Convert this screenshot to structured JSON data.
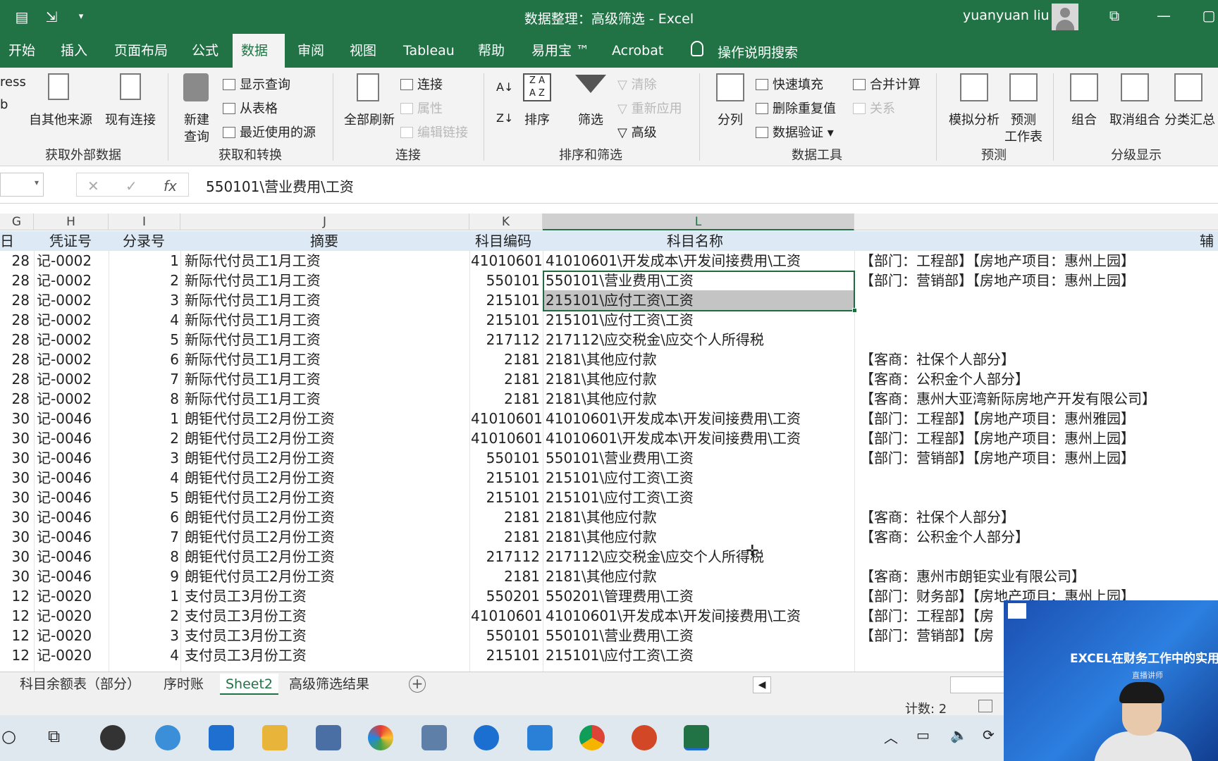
{
  "titlebar": {
    "title": "数据整理：高级筛选  -  Excel",
    "user": "yuanyuan liu",
    "qa_dropdown": "▾",
    "win_restore": "⧉",
    "win_minimize": "—",
    "win_max": "▢"
  },
  "tabs": {
    "items": [
      "开始",
      "插入",
      "页面布局",
      "公式",
      "数据",
      "审阅",
      "视图",
      "Tableau",
      "帮助",
      "易用宝 ™",
      "Acrobat"
    ],
    "active": "数据",
    "tellme": "操作说明搜索"
  },
  "ribbon": {
    "partial_left": [
      "ress",
      "b"
    ],
    "get_external": {
      "from_other": "自其他来源",
      "existing": "现有连接",
      "label": "获取外部数据"
    },
    "get_transform": {
      "new_query": "新建",
      "new_query2": "查询",
      "show_query": "显示查询",
      "from_table": "从表格",
      "recent": "最近使用的源",
      "label": "获取和转换"
    },
    "connections": {
      "refresh_all": "全部刷新",
      "connections": "连接",
      "properties": "属性",
      "edit_links": "编辑链接",
      "label": "连接"
    },
    "sort_filter": {
      "sort": "排序",
      "filter": "筛选",
      "clear": "清除",
      "reapply": "重新应用",
      "advanced": "高级",
      "label": "排序和筛选"
    },
    "data_tools": {
      "text_to_columns": "分列",
      "flash_fill": "快速填充",
      "remove_dup": "删除重复值",
      "validation": "数据验证",
      "consolidate": "合并计算",
      "relationships": "关系",
      "label": "数据工具"
    },
    "forecast": {
      "whatif": "模拟分析",
      "sheet": "预测",
      "sheet2": "工作表",
      "label": "预测"
    },
    "outline": {
      "group": "组合",
      "ungroup": "取消组合",
      "subtotal": "分类汇总",
      "label": "分级显示"
    }
  },
  "formula_bar": {
    "content": "550101\\营业费用\\工资",
    "fx": "fx",
    "cancel": "✕",
    "enter": "✓"
  },
  "columns": [
    "G",
    "H",
    "I",
    "J",
    "K",
    "L"
  ],
  "table": {
    "header": {
      "g": "日",
      "h": "凭证号",
      "i": "分录号",
      "j": "摘要",
      "k": "科目编码",
      "l": "科目名称",
      "n": "辅"
    },
    "rows": [
      {
        "g": "28",
        "h": "记-0002",
        "i": "1",
        "j": "新际代付员工1月工资",
        "k": "41010601",
        "l": "41010601\\开发成本\\开发间接费用\\工资",
        "m": "【部门：工程部】【房地产项目：惠州上园】"
      },
      {
        "g": "28",
        "h": "记-0002",
        "i": "2",
        "j": "新际代付员工1月工资",
        "k": "550101",
        "l": "550101\\营业费用\\工资",
        "m": "【部门：营销部】【房地产项目：惠州上园】"
      },
      {
        "g": "28",
        "h": "记-0002",
        "i": "3",
        "j": "新际代付员工1月工资",
        "k": "215101",
        "l": "215101\\应付工资\\工资",
        "m": ""
      },
      {
        "g": "28",
        "h": "记-0002",
        "i": "4",
        "j": "新际代付员工1月工资",
        "k": "215101",
        "l": "215101\\应付工资\\工资",
        "m": ""
      },
      {
        "g": "28",
        "h": "记-0002",
        "i": "5",
        "j": "新际代付员工1月工资",
        "k": "217112",
        "l": "217112\\应交税金\\应交个人所得税",
        "m": ""
      },
      {
        "g": "28",
        "h": "记-0002",
        "i": "6",
        "j": "新际代付员工1月工资",
        "k": "2181",
        "l": "2181\\其他应付款",
        "m": "【客商：社保个人部分】"
      },
      {
        "g": "28",
        "h": "记-0002",
        "i": "7",
        "j": "新际代付员工1月工资",
        "k": "2181",
        "l": "2181\\其他应付款",
        "m": "【客商：公积金个人部分】"
      },
      {
        "g": "28",
        "h": "记-0002",
        "i": "8",
        "j": "新际代付员工1月工资",
        "k": "2181",
        "l": "2181\\其他应付款",
        "m": "【客商：惠州大亚湾新际房地产开发有限公司】"
      },
      {
        "g": "30",
        "h": "记-0046",
        "i": "1",
        "j": "朗钜代付员工2月份工资",
        "k": "41010601",
        "l": "41010601\\开发成本\\开发间接费用\\工资",
        "m": "【部门：工程部】【房地产项目：惠州雅园】"
      },
      {
        "g": "30",
        "h": "记-0046",
        "i": "2",
        "j": "朗钜代付员工2月份工资",
        "k": "41010601",
        "l": "41010601\\开发成本\\开发间接费用\\工资",
        "m": "【部门：工程部】【房地产项目：惠州上园】"
      },
      {
        "g": "30",
        "h": "记-0046",
        "i": "3",
        "j": "朗钜代付员工2月份工资",
        "k": "550101",
        "l": "550101\\营业费用\\工资",
        "m": "【部门：营销部】【房地产项目：惠州上园】"
      },
      {
        "g": "30",
        "h": "记-0046",
        "i": "4",
        "j": "朗钜代付员工2月份工资",
        "k": "215101",
        "l": "215101\\应付工资\\工资",
        "m": ""
      },
      {
        "g": "30",
        "h": "记-0046",
        "i": "5",
        "j": "朗钜代付员工2月份工资",
        "k": "215101",
        "l": "215101\\应付工资\\工资",
        "m": ""
      },
      {
        "g": "30",
        "h": "记-0046",
        "i": "6",
        "j": "朗钜代付员工2月份工资",
        "k": "2181",
        "l": "2181\\其他应付款",
        "m": "【客商：社保个人部分】"
      },
      {
        "g": "30",
        "h": "记-0046",
        "i": "7",
        "j": "朗钜代付员工2月份工资",
        "k": "2181",
        "l": "2181\\其他应付款",
        "m": "【客商：公积金个人部分】"
      },
      {
        "g": "30",
        "h": "记-0046",
        "i": "8",
        "j": "朗钜代付员工2月份工资",
        "k": "217112",
        "l": "217112\\应交税金\\应交个人所得税",
        "m": ""
      },
      {
        "g": "30",
        "h": "记-0046",
        "i": "9",
        "j": "朗钜代付员工2月份工资",
        "k": "2181",
        "l": "2181\\其他应付款",
        "m": "【客商：惠州市朗钜实业有限公司】"
      },
      {
        "g": "12",
        "h": "记-0020",
        "i": "1",
        "j": "支付员工3月份工资",
        "k": "550201",
        "l": "550201\\管理费用\\工资",
        "m": "【部门：财务部】【房地产项目：惠州上园】"
      },
      {
        "g": "12",
        "h": "记-0020",
        "i": "2",
        "j": "支付员工3月份工资",
        "k": "41010601",
        "l": "41010601\\开发成本\\开发间接费用\\工资",
        "m": "【部门：工程部】【房"
      },
      {
        "g": "12",
        "h": "记-0020",
        "i": "3",
        "j": "支付员工3月份工资",
        "k": "550101",
        "l": "550101\\营业费用\\工资",
        "m": "【部门：营销部】【房"
      },
      {
        "g": "12",
        "h": "记-0020",
        "i": "4",
        "j": "支付员工3月份工资",
        "k": "215101",
        "l": "215101\\应付工资\\工资",
        "m": ""
      }
    ]
  },
  "sheets": {
    "items": [
      "科目余额表（部分）",
      "序时账",
      "Sheet2",
      "高级筛选结果"
    ],
    "active": "Sheet2",
    "add": "+"
  },
  "status": {
    "count": "计数: 2"
  },
  "webcam": {
    "title": "EXCEL在财务工作中的实用",
    "subtitle": "直播讲师"
  },
  "colors": {
    "excel_green": "#217346",
    "header_fill": "#dde9f5",
    "selection_fill": "#c4c4c4"
  }
}
